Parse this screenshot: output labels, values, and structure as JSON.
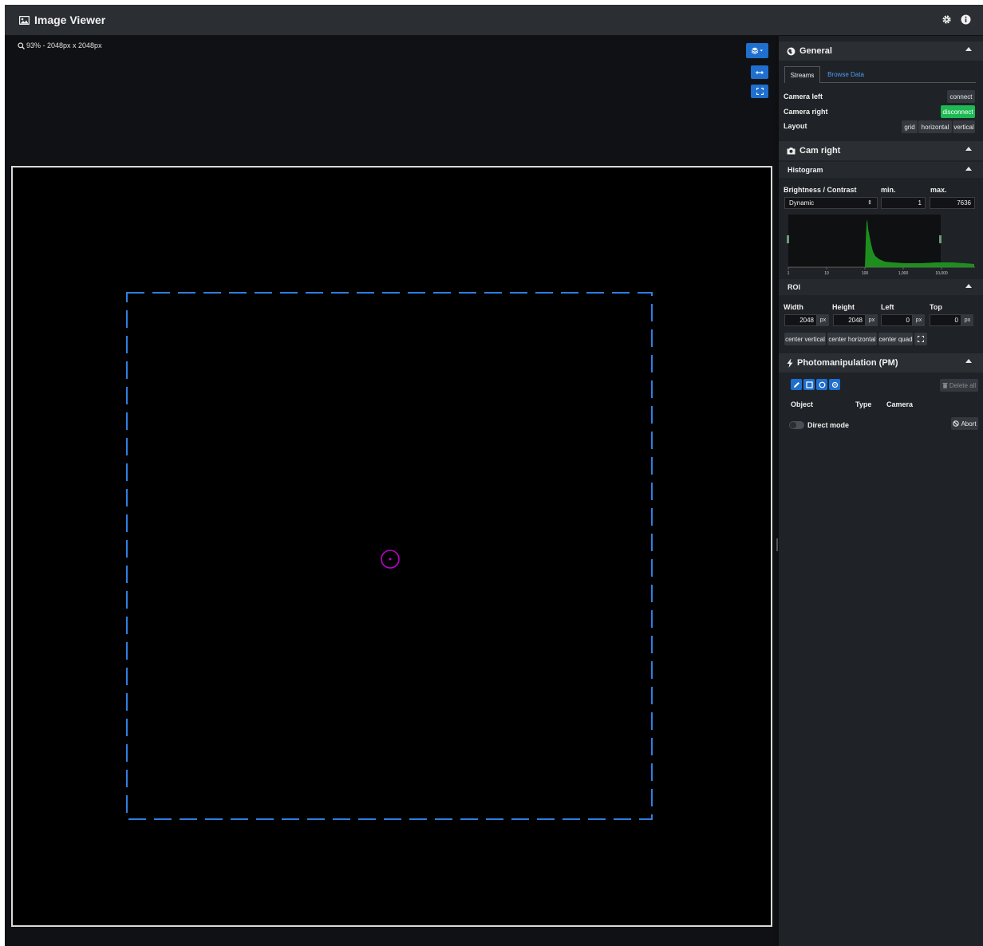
{
  "app": {
    "title": "Image Viewer",
    "icons": [
      "image-icon",
      "gear-icon",
      "info-icon"
    ]
  },
  "viewer": {
    "zoom_text": "93% - 2048px x 2048px",
    "buttons": [
      "layers-dropdown-icon",
      "fit-width-icon",
      "fullscreen-icon"
    ],
    "colors": {
      "roi": "#2f7fe0",
      "marker": "#c000d0",
      "canvas_border": "#d9d9d9"
    }
  },
  "general": {
    "title": "General",
    "tabs": [
      "Streams",
      "Browse Data"
    ],
    "active_tab": "Streams",
    "camera_left": {
      "label": "Camera left",
      "button": "connect"
    },
    "camera_right": {
      "label": "Camera right",
      "button": "disconnect"
    },
    "layout": {
      "label": "Layout",
      "options": [
        "grid",
        "horizontal",
        "vertical"
      ]
    }
  },
  "cam": {
    "title": "Cam right",
    "histogram": {
      "title": "Histogram",
      "brightness_label": "Brightness / Contrast",
      "min_label": "min.",
      "max_label": "max.",
      "mode": "Dynamic",
      "min": "1",
      "max": "7636",
      "ticks": [
        "1",
        "10",
        "100",
        "1,000",
        "10,000"
      ]
    },
    "roi": {
      "title": "ROI",
      "labels": [
        "Width",
        "Height",
        "Left",
        "Top"
      ],
      "values": [
        "2048",
        "2048",
        "0",
        "0"
      ],
      "unit": "px",
      "buttons": [
        "center vertical",
        "center horizontal",
        "center quad"
      ]
    }
  },
  "pm": {
    "title": "Photomanipulation (PM)",
    "tools": [
      "pencil-icon",
      "square-icon",
      "circle-icon",
      "crosshair-icon"
    ],
    "delete_all": "Delete all",
    "columns": [
      "Object",
      "Type",
      "Camera"
    ],
    "direct_mode": "Direct mode",
    "abort": "Abort"
  },
  "colors": {
    "accent": "#1f6fcf",
    "success": "#1db954",
    "link": "#4a9ef5"
  }
}
